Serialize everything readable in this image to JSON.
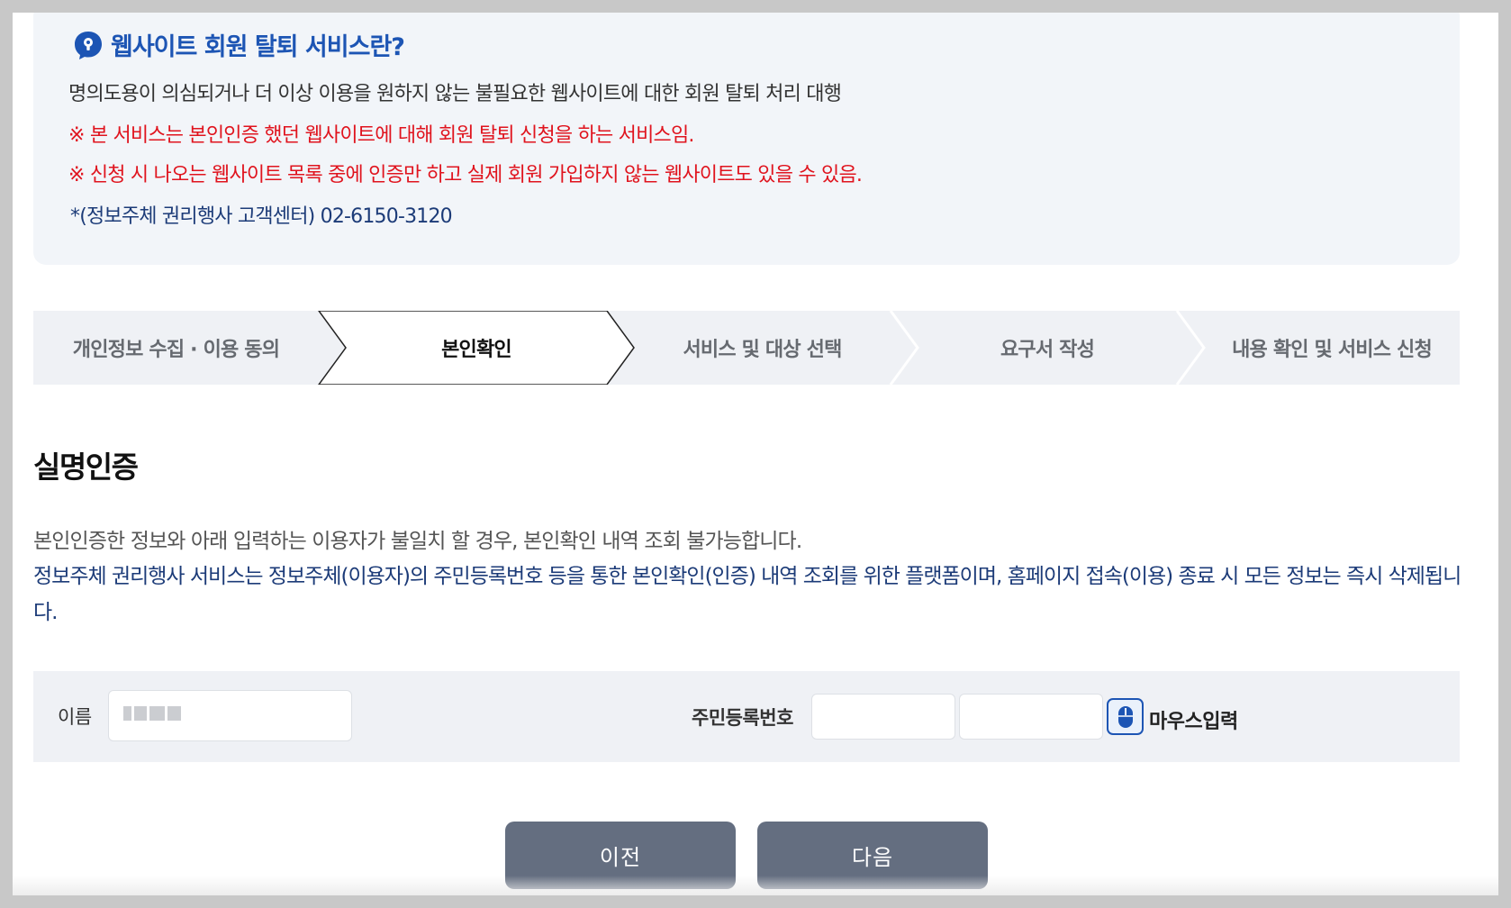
{
  "info": {
    "title": "웹사이트 회원 탈퇴 서비스란?",
    "description": "명의도용이 의심되거나 더 이상 이용을 원하지 않는 불필요한 웹사이트에 대한 회원 탈퇴 처리 대행",
    "notice1": "※ 본 서비스는 본인인증 했던 웹사이트에 대해 회원 탈퇴 신청을 하는 서비스임.",
    "notice2": "※ 신청 시 나오는 웹사이트 목록 중에 인증만 하고 실제 회원 가입하지 않는 웹사이트도 있을 수 있음.",
    "contact": "*(정보주체 권리행사 고객센터) 02-6150-3120"
  },
  "steps": [
    {
      "label": "개인정보 수집 · 이용 동의",
      "active": false
    },
    {
      "label": "본인확인",
      "active": true
    },
    {
      "label": "서비스 및 대상 선택",
      "active": false
    },
    {
      "label": "요구서 작성",
      "active": false
    },
    {
      "label": "내용 확인 및 서비스 신청",
      "active": false
    }
  ],
  "section": {
    "title": "실명인증",
    "desc1": "본인인증한 정보와 아래 입력하는 이용자가 불일치 할 경우, 본인확인 내역 조회 불가능합니다.",
    "desc2": "정보주체 권리행사 서비스는 정보주체(이용자)의 주민등록번호 등을 통한 본인확인(인증) 내역 조회를 위한 플랫폼이며, 홈페이지 접속(이용) 종료 시 모든 정보는 즉시 삭제됩니다."
  },
  "form": {
    "name_label": "이름",
    "rrn_label": "주민등록번호",
    "mouse_input_label": "마우스입력"
  },
  "buttons": {
    "prev": "이전",
    "next": "다음"
  },
  "colors": {
    "title_blue": "#1d55b4",
    "notice_red": "#e0141e",
    "dark_navy": "#1c3b78",
    "button_gray": "#646e80"
  }
}
